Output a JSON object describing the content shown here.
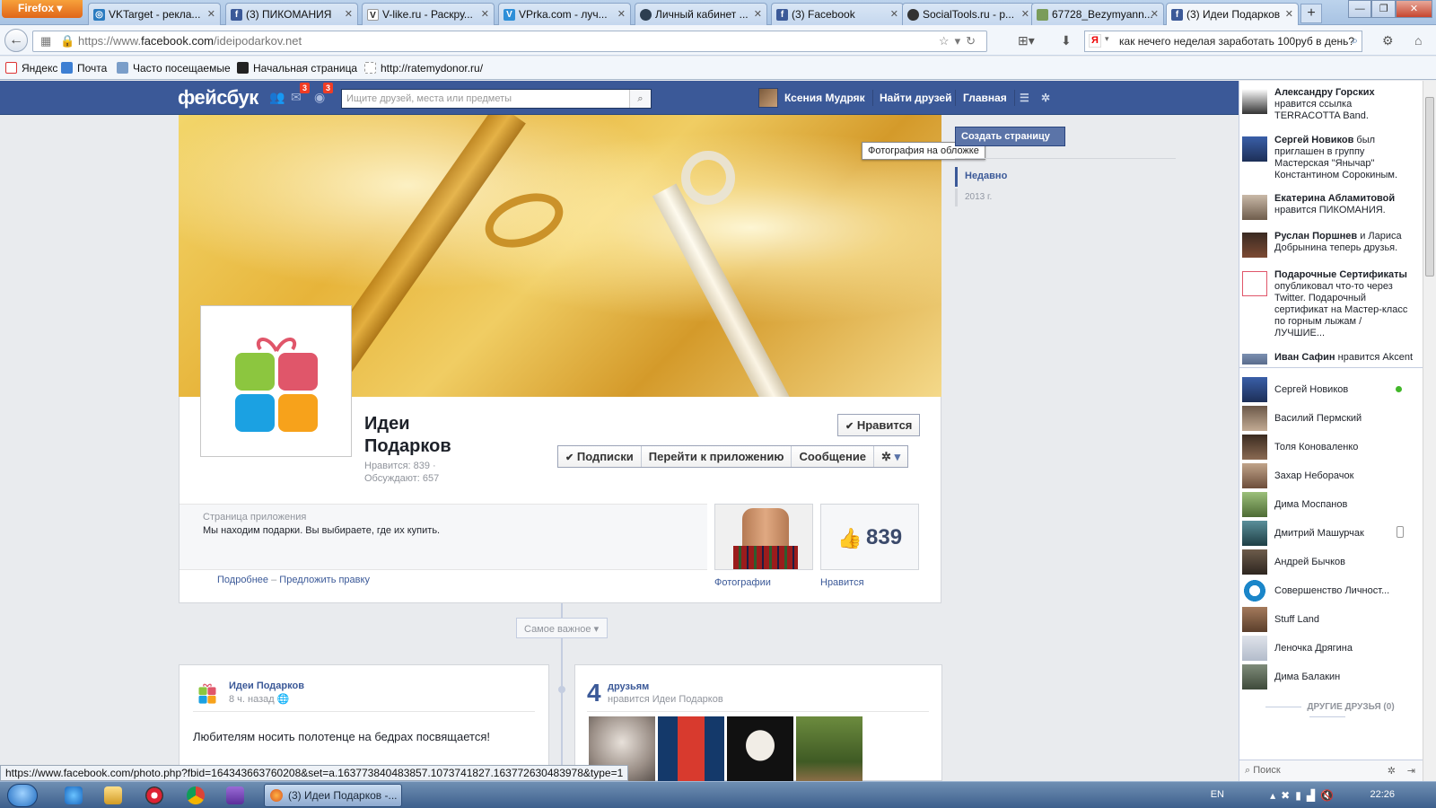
{
  "browser": {
    "menu_label": "Firefox",
    "tabs": [
      {
        "label": "VKTarget - рекла...",
        "icon": "V"
      },
      {
        "label": "(3) ПИКОМАНИЯ",
        "icon": "f"
      },
      {
        "label": "V-like.ru - Раскру...",
        "icon": "V"
      },
      {
        "label": "VPrka.com - луч...",
        "icon": "V"
      },
      {
        "label": "Личный кабинет ...",
        "icon": "●"
      },
      {
        "label": "(3) Facebook",
        "icon": "f"
      },
      {
        "label": "SocialTools.ru - р...",
        "icon": "●"
      },
      {
        "label": "67728_Bezymyann...",
        "icon": "▣"
      },
      {
        "label": "(3) Идеи Подарков",
        "icon": "f"
      }
    ],
    "url_prefix": "https://www.",
    "url_domain": "facebook.com",
    "url_path": "/ideipodarkov.net",
    "search_query": "как нечего неделая заработать 100руб в день?",
    "bookmarks": [
      "Яндекс",
      "Почта",
      "Часто посещаемые",
      "Начальная страница",
      "http://ratemydonor.ru/"
    ],
    "status_url": "https://www.facebook.com/photo.php?fbid=164343663760208&set=a.163773840483857.1073741827.163772630483978&type=1"
  },
  "fb": {
    "logo": "фейсбук",
    "search_placeholder": "Ищите друзей, места или предметы",
    "notif_count_1": "3",
    "notif_count_2": "3",
    "user_name": "Ксения Мудряк",
    "find_friends": "Найти друзей",
    "home": "Главная"
  },
  "page": {
    "cover_tooltip": "Фотография на обложке",
    "create_page": "Создать страницу",
    "timeline_recent": "Недавно",
    "timeline_year": "2013 г.",
    "name_line1": "Идеи",
    "name_line2": "Подарков",
    "likes_stat": "Нравится: 839 ·",
    "talking_stat": "Обсуждают: 657",
    "like_button": "Нравится",
    "buttons": [
      "Подписки",
      "Перейти к приложению",
      "Сообщение"
    ],
    "about_label": "Страница приложения",
    "about_text": "Мы находим подарки. Вы выбираете, где их купить.",
    "more_link": "Подробнее",
    "suggest_link": "Предложить правку",
    "photos_label": "Фотографии",
    "likes_label": "Нравится",
    "likes_count": "839",
    "filter_label": "Самое важное"
  },
  "post": {
    "author": "Идеи Подарков",
    "time": "8 ч. назад",
    "text": "Любителям носить полотенце на бедрах посвящается!"
  },
  "friends_box": {
    "count": "4",
    "word": "друзьям",
    "sub": "нравится Идеи Подарков"
  },
  "ticker": [
    {
      "name": "Александру Горских",
      "text": "нравится ссылка TERRACOTTA Band."
    },
    {
      "name": "Сергей Новиков",
      "text": "был приглашен в группу Мастерская \"Янычар\" Константином Сорокиным."
    },
    {
      "name": "Екатерина Абламитовой",
      "text": "нравится ПИКОМАНИЯ."
    },
    {
      "name": "Руслан Поршнев",
      "text": "и Лариса Добрынина теперь друзья."
    },
    {
      "name": "Подарочные Сертификаты",
      "text": "опубликовал что-то через Twitter. Подарочный сертификат на Мастер-класс по горным лыжам / ЛУЧШИЕ..."
    },
    {
      "name": "Иван Сафин",
      "text": "нравится Akcent"
    }
  ],
  "chat": [
    {
      "name": "Сергей Новиков",
      "status": "online"
    },
    {
      "name": "Василий Пермский",
      "status": ""
    },
    {
      "name": "Толя Коноваленко",
      "status": ""
    },
    {
      "name": "Захар Неборачок",
      "status": ""
    },
    {
      "name": "Дима Моспанов",
      "status": ""
    },
    {
      "name": "Дмитрий Машурчак",
      "status": "mobile"
    },
    {
      "name": "Андрей Бычков",
      "status": ""
    },
    {
      "name": "Совершенство Личност...",
      "status": ""
    },
    {
      "name": "Stuff Land",
      "status": ""
    },
    {
      "name": "Леночка Дрягина",
      "status": ""
    },
    {
      "name": "Дима Балакин",
      "status": ""
    }
  ],
  "chat_other": "ДРУГИЕ ДРУЗЬЯ (0)",
  "chat_search": "Поиск",
  "taskbar": {
    "task_label": "(3) Идеи Подарков -...",
    "lang": "EN",
    "clock": "22:26"
  },
  "colors": {
    "fb_blue": "#3b5998",
    "gift_green": "#8cc63f",
    "gift_red": "#e0566a",
    "gift_blue": "#1ba1e2",
    "gift_orange": "#f7a21b"
  }
}
